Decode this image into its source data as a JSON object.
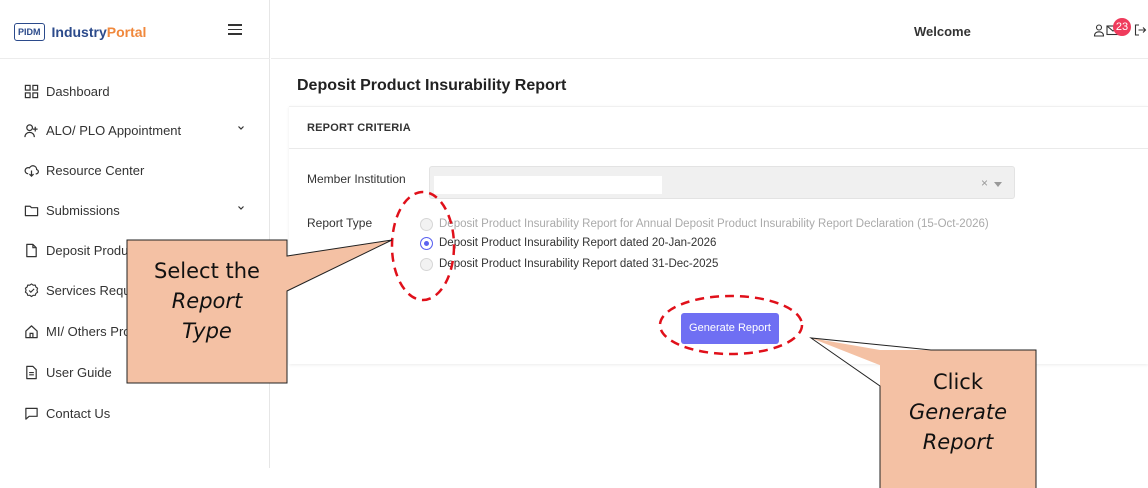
{
  "brand": {
    "box": "PIDM",
    "name_primary": "Industry",
    "name_accent": "Portal"
  },
  "sidebar": {
    "items": [
      {
        "label": "Dashboard",
        "icon": "grid-icon"
      },
      {
        "label": "ALO/ PLO Appointment",
        "icon": "user-plus-icon",
        "expandable": true
      },
      {
        "label": "Resource Center",
        "icon": "cloud-download-icon"
      },
      {
        "label": "Submissions",
        "icon": "folder-icon",
        "expandable": true
      },
      {
        "label": "Deposit Produ",
        "icon": "file-icon"
      },
      {
        "label": "Services Reque",
        "icon": "badge-icon"
      },
      {
        "label": "MI/ Others Pro",
        "icon": "home-icon"
      },
      {
        "label": "User Guide",
        "icon": "document-icon"
      },
      {
        "label": "Contact Us",
        "icon": "message-icon"
      }
    ]
  },
  "header": {
    "welcome": "Welcome",
    "notification_count": "23"
  },
  "main": {
    "title": "Deposit Product Insurability Report",
    "card_header": "REPORT CRITERIA",
    "member_institution_label": "Member Institution",
    "member_institution_value": "",
    "select_clear": "×",
    "report_type_label": "Report Type",
    "report_options": [
      {
        "label": "Deposit Product Insurability Report for Annual Deposit Product Insurability Report Declaration (15-Oct-2026)",
        "state": "disabled"
      },
      {
        "label": "Deposit Product Insurability Report dated 20-Jan-2026",
        "state": "checked"
      },
      {
        "label": "Deposit Product Insurability Report dated 31-Dec-2025",
        "state": "unchecked"
      }
    ],
    "generate_button": "Generate Report",
    "accent_color": "#6f6ff3"
  },
  "annotations": {
    "left_callout": {
      "line1": "Select the",
      "line2": "Report",
      "line3": "Type"
    },
    "right_callout": {
      "line1": "Click",
      "line2": "Generate",
      "line3": "Report"
    },
    "callout_fill": "#f4c1a4",
    "circle_color": "#e0101a"
  }
}
